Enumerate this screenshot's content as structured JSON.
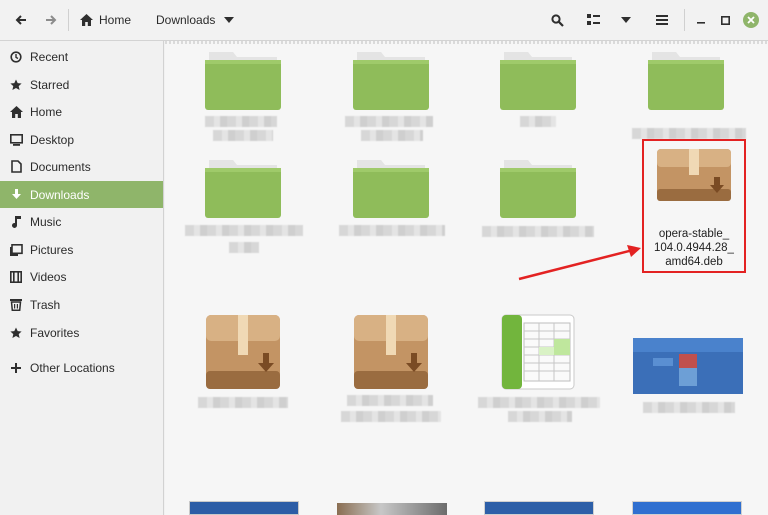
{
  "header": {
    "back_icon": "arrow-left-icon",
    "forward_icon": "arrow-right-icon",
    "crumbs": [
      {
        "label": "Home",
        "icon": "home-icon"
      },
      {
        "label": "Downloads",
        "icon": "chevron-down-icon"
      }
    ],
    "tools": [
      "search-icon",
      "view-toggle-icon",
      "view-dropdown-icon",
      "menu-icon"
    ],
    "window_controls": [
      "minimize-icon",
      "maximize-icon",
      "close-icon"
    ]
  },
  "sidebar": {
    "items": [
      {
        "label": "Recent",
        "icon": "recent-icon"
      },
      {
        "label": "Starred",
        "icon": "star-icon"
      },
      {
        "label": "Home",
        "icon": "home-icon"
      },
      {
        "label": "Desktop",
        "icon": "desktop-icon"
      },
      {
        "label": "Documents",
        "icon": "document-icon"
      },
      {
        "label": "Downloads",
        "icon": "download-icon",
        "active": true
      },
      {
        "label": "Music",
        "icon": "music-icon"
      },
      {
        "label": "Pictures",
        "icon": "pictures-icon"
      },
      {
        "label": "Videos",
        "icon": "video-icon"
      },
      {
        "label": "Trash",
        "icon": "trash-icon"
      },
      {
        "label": "Favorites",
        "icon": "star-icon"
      },
      {
        "label": "Other Locations",
        "icon": "plus-icon"
      }
    ]
  },
  "main": {
    "highlighted_file": {
      "name_lines": [
        "opera-stable_",
        "104.0.4944.28_",
        "amd64.deb"
      ],
      "icon": "package-icon"
    },
    "colors": {
      "accent": "#8fb56a",
      "folder": "#8fbc5a",
      "highlight": "#e32222"
    }
  }
}
